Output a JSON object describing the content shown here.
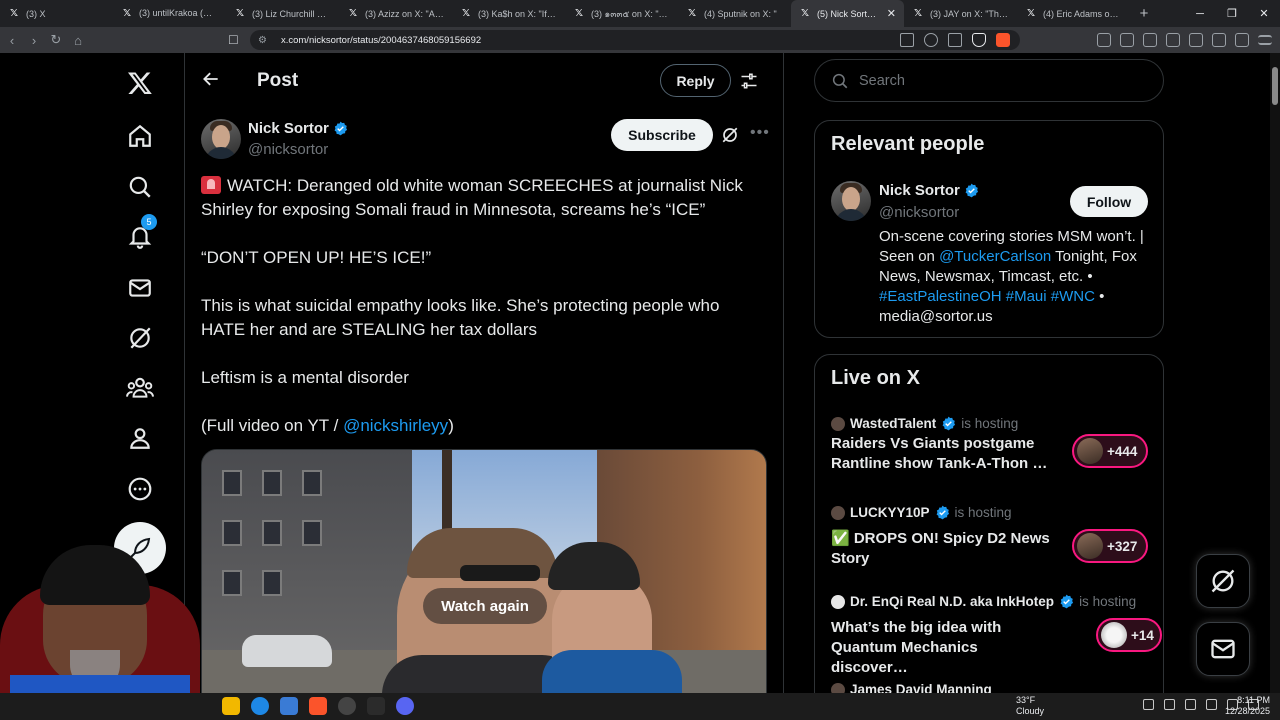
{
  "browser": {
    "tabs": [
      {
        "label": "(3) X",
        "active": false
      },
      {
        "label": "(3) untilKrakoa (👁️) W",
        "active": false
      },
      {
        "label": "(3) Liz Churchill on X: \"",
        "active": false
      },
      {
        "label": "(3) Azizz on X: \"Aloha",
        "active": false
      },
      {
        "label": "(3) Ka$h on X: \"If my d",
        "active": false
      },
      {
        "label": "(3) ๑๓๓๕ on X: \"Kai Ce",
        "active": false
      },
      {
        "label": "(4) Sputnik on X: \"",
        "active": false
      },
      {
        "label": "(5) Nick Sortor on",
        "active": true
      },
      {
        "label": "(3) JAY on X: \"This guy",
        "active": false
      },
      {
        "label": "(4) Eric Adams on X: \"I",
        "active": false
      }
    ],
    "url": "x.com/nicksortor/status/2004637468059156692"
  },
  "nav": {
    "notifications_badge": "5"
  },
  "header": {
    "title": "Post",
    "reply_label": "Reply"
  },
  "post": {
    "author_name": "Nick Sortor",
    "author_handle": "@nicksortor",
    "subscribe_label": "Subscribe",
    "para1": "WATCH: Deranged old white woman SCREECHES at journalist Nick Shirley for exposing Somali fraud in Minnesota, screams he’s “ICE”",
    "para2": "“DON’T OPEN UP! HE’S ICE!”",
    "para3": "This is what suicidal empathy looks like. She’s protecting people who HATE her and are STEALING her tax dollars",
    "para4": "Leftism is a mental disorder",
    "para5_prefix": "(Full video on YT / ",
    "para5_link": "@nickshirleyy",
    "para5_suffix": ")",
    "video_overlay": "Watch again"
  },
  "search": {
    "placeholder": "Search"
  },
  "relevant_people": {
    "title": "Relevant people",
    "name": "Nick Sortor",
    "handle": "@nicksortor",
    "follow_label": "Follow",
    "bio_1": "On-scene covering stories MSM won’t. | Seen on ",
    "bio_link1": "@TuckerCarlson",
    "bio_2": " Tonight, Fox News, Newsmax, Timcast, etc. • ",
    "bio_link2": "#EastPalestineOH",
    "bio_link3": "#Maui",
    "bio_link4": "#WNC",
    "bio_3": " • media@sortor.us"
  },
  "live": {
    "title": "Live on X",
    "hosting_label": "is hosting",
    "items": [
      {
        "host": "WastedTalent",
        "title": "Raiders Vs Giants postgame Rantline show Tank-A-Thon …",
        "count": "+444"
      },
      {
        "host": "LUCKYY10P",
        "title": "✅ DROPS ON! Spicy D2 News Story",
        "count": "+327"
      },
      {
        "host": "Dr. EnQi Real N.D. aka InkHotep",
        "title": "What’s the big idea with Quantum Mechanics discover…",
        "count": "+14"
      },
      {
        "host": "James David Manning"
      }
    ]
  },
  "taskbar": {
    "temp": "33°F",
    "weather": "Cloudy",
    "time": "8:11 PM",
    "date": "12/28/2025"
  },
  "colors": {
    "accent": "#1d9bf0",
    "live_pink": "#f91880",
    "border": "#2f3336",
    "muted": "#71767b"
  }
}
